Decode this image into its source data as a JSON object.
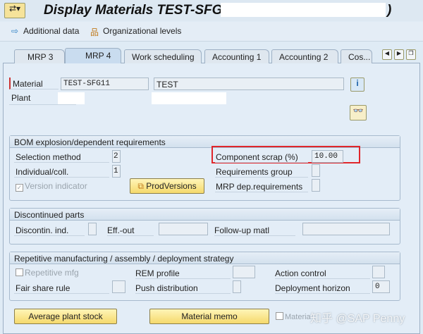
{
  "header": {
    "title": "Display Materials TEST-SFG11 (",
    "title_close": ")"
  },
  "toolbar": {
    "additional_data": "Additional data",
    "org_levels": "Organizational levels"
  },
  "tabs": [
    "MRP 3",
    "MRP 4",
    "Work scheduling",
    "Accounting 1",
    "Accounting 2",
    "Cos..."
  ],
  "active_tab": "MRP 4",
  "material": {
    "label": "Material",
    "value": "TEST-SFG11",
    "description": "TEST",
    "plant_label": "Plant"
  },
  "bom": {
    "title": "BOM explosion/dependent requirements",
    "selection_method_label": "Selection method",
    "selection_method": "2",
    "individual_label": "Individual/coll.",
    "individual": "1",
    "version_indicator": "Version indicator",
    "version_checked": true,
    "prodversions": "ProdVersions",
    "component_scrap_label": "Component scrap (%)",
    "component_scrap": "10.00",
    "req_group_label": "Requirements group",
    "mrp_dep_label": "MRP dep.requirements",
    "highlight_color": "#e0262b"
  },
  "discontinued": {
    "title": "Discontinued parts",
    "discontin_label": "Discontin. ind.",
    "eff_out_label": "Eff.-out",
    "followup_label": "Follow-up matl"
  },
  "repetitive": {
    "title": "Repetitive manufacturing / assembly / deployment strategy",
    "rep_mfg": "Repetitive mfg",
    "rem_profile": "REM profile",
    "action_control": "Action control",
    "fair_share": "Fair share rule",
    "push_dist": "Push distribution",
    "deploy_horizon": "Deployment horizon",
    "deploy_horizon_value": "0"
  },
  "footer": {
    "avg_plant_stock": "Average plant stock",
    "material_memo": "Material memo",
    "memo_checkbox": "Materia",
    "watermark": "知乎 @SAP Penny"
  }
}
